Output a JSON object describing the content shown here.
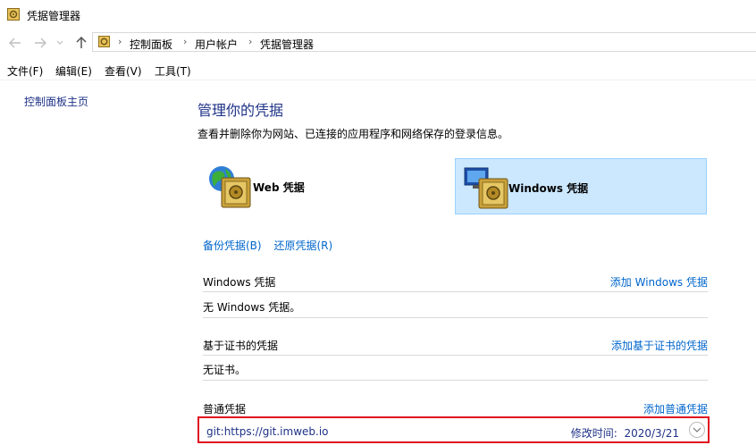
{
  "window": {
    "title": "凭据管理器"
  },
  "address_bar": {
    "crumbs": [
      "控制面板",
      "用户帐户",
      "凭据管理器"
    ]
  },
  "menu": [
    "文件(F)",
    "编辑(E)",
    "查看(V)",
    "工具(T)"
  ],
  "sidebar": {
    "home_link": "控制面板主页"
  },
  "main": {
    "heading": "管理你的凭据",
    "description": "查看并删除你为网站、已连接的应用程序和网络保存的登录信息。",
    "cred_types": [
      {
        "label": "Web 凭据",
        "selected": false
      },
      {
        "label": "Windows 凭据",
        "selected": true
      }
    ],
    "backup_link": "备份凭据(B)",
    "restore_link": "还原凭据(R)",
    "sections": [
      {
        "title": "Windows 凭据",
        "add_link": "添加 Windows 凭据",
        "empty_text": "无 Windows 凭据。"
      },
      {
        "title": "基于证书的凭据",
        "add_link": "添加基于证书的凭据",
        "empty_text": "无证书。"
      },
      {
        "title": "普通凭据",
        "add_link": "添加普通凭据"
      }
    ],
    "entries": [
      {
        "name": "git:https://git.imweb.io",
        "modified_label": "修改时间:",
        "modified_date": "2020/3/21"
      }
    ]
  },
  "colors": {
    "link": "#0066cc",
    "heading": "#1e3287",
    "selected_bg": "#cce8ff",
    "highlight_border": "#e01020"
  }
}
